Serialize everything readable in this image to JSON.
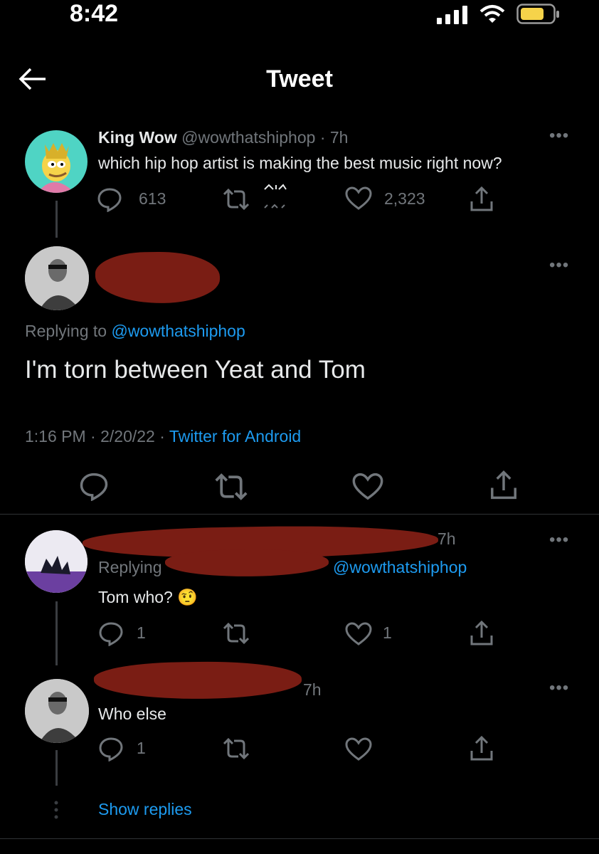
{
  "status_bar": {
    "time": "8:42"
  },
  "header": {
    "title": "Tweet"
  },
  "original_tweet": {
    "display_name": "King Wow",
    "handle": "@wowthatshiphop",
    "time": "· 7h",
    "text": "which hip hop artist is making the best music right now?",
    "replies": "613",
    "likes": "2,323"
  },
  "main_tweet": {
    "replying_prefix": "Replying to ",
    "replying_handle": "@wowthatshiphop",
    "text": "I'm torn between Yeat and Tom",
    "meta_time": "1:16 PM · 2/20/22 · ",
    "meta_source": "Twitter for Android"
  },
  "reply_1": {
    "time": "7h",
    "replying_prefix": "Replying",
    "replying_handle": "@wowthatshiphop",
    "text": "Tom who?",
    "emoji": "🤨",
    "replies": "1",
    "likes": "1"
  },
  "reply_2": {
    "time": "7h",
    "text": "Who else",
    "replies": "1"
  },
  "show_replies": "Show replies",
  "colors": {
    "background": "#000000",
    "accent": "#1d9bf0",
    "muted": "#71767b",
    "redaction": "#7a1d14",
    "battery": "#f6d34a"
  }
}
